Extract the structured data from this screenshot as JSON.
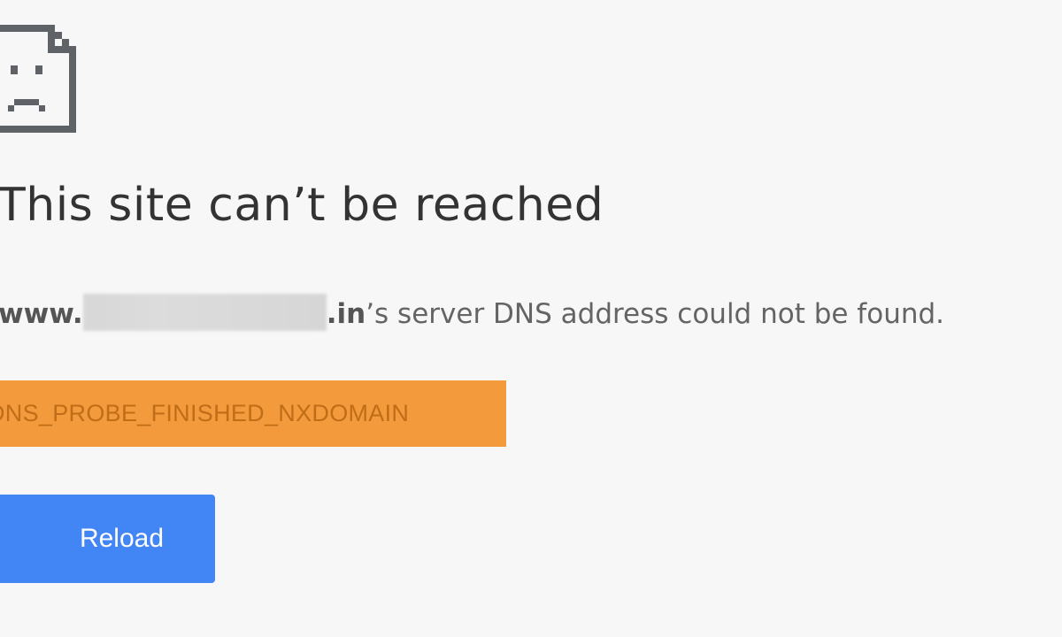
{
  "error_page": {
    "icon": "sad-page-icon",
    "heading": "This site can’t be reached",
    "message": {
      "host_prefix": "www.",
      "host_suffix": ".in",
      "text": "’s server DNS address could not be found."
    },
    "error_code": "DNS_PROBE_FINISHED_NXDOMAIN",
    "reload_label": "Reload"
  },
  "colors": {
    "background": "#f7f7f7",
    "heading": "#333333",
    "message": "#646464",
    "error_code_highlight": "#f39a3c",
    "reload_button": "#4285f4"
  }
}
